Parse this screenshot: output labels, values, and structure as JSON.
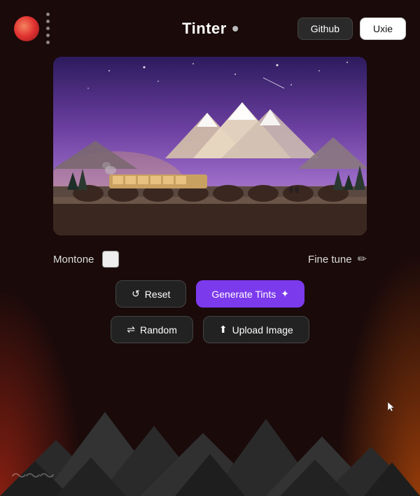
{
  "header": {
    "title": "Tinter",
    "github_label": "Github",
    "uxie_label": "Uxie"
  },
  "controls": {
    "montone_label": "Montone",
    "finetune_label": "Fine tune"
  },
  "buttons": {
    "reset_label": "Reset",
    "generate_label": "Generate Tints",
    "random_label": "Random",
    "upload_label": "Upload Image"
  },
  "icons": {
    "reset": "↺",
    "generate": "✦",
    "random": "⇌",
    "upload": "⬆",
    "pencil": "✏"
  }
}
